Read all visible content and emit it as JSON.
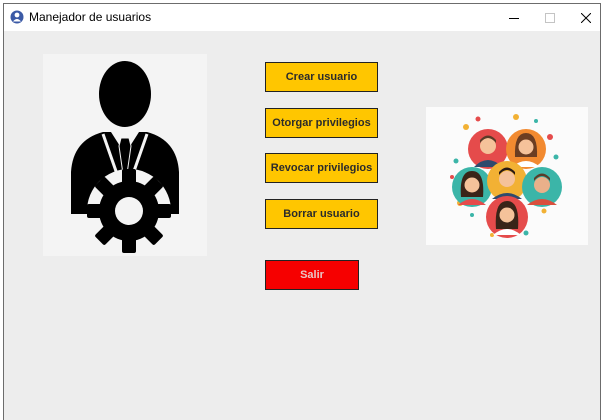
{
  "window": {
    "title": "Manejador de usuarios",
    "controls": {
      "minimize": "minimize",
      "maximize": "maximize",
      "close": "close"
    }
  },
  "buttons": {
    "create_user": "Crear usuario",
    "grant_privileges": "Otorgar privilegios",
    "revoke_privileges": "Revocar privilegios",
    "delete_user": "Borrar usuario",
    "exit": "Salir"
  },
  "images": {
    "left": "admin-user-gear-icon",
    "right": "user-group-avatars"
  },
  "colors": {
    "action_button": "#ffc600",
    "exit_button": "#f60000",
    "background": "#ededed"
  }
}
